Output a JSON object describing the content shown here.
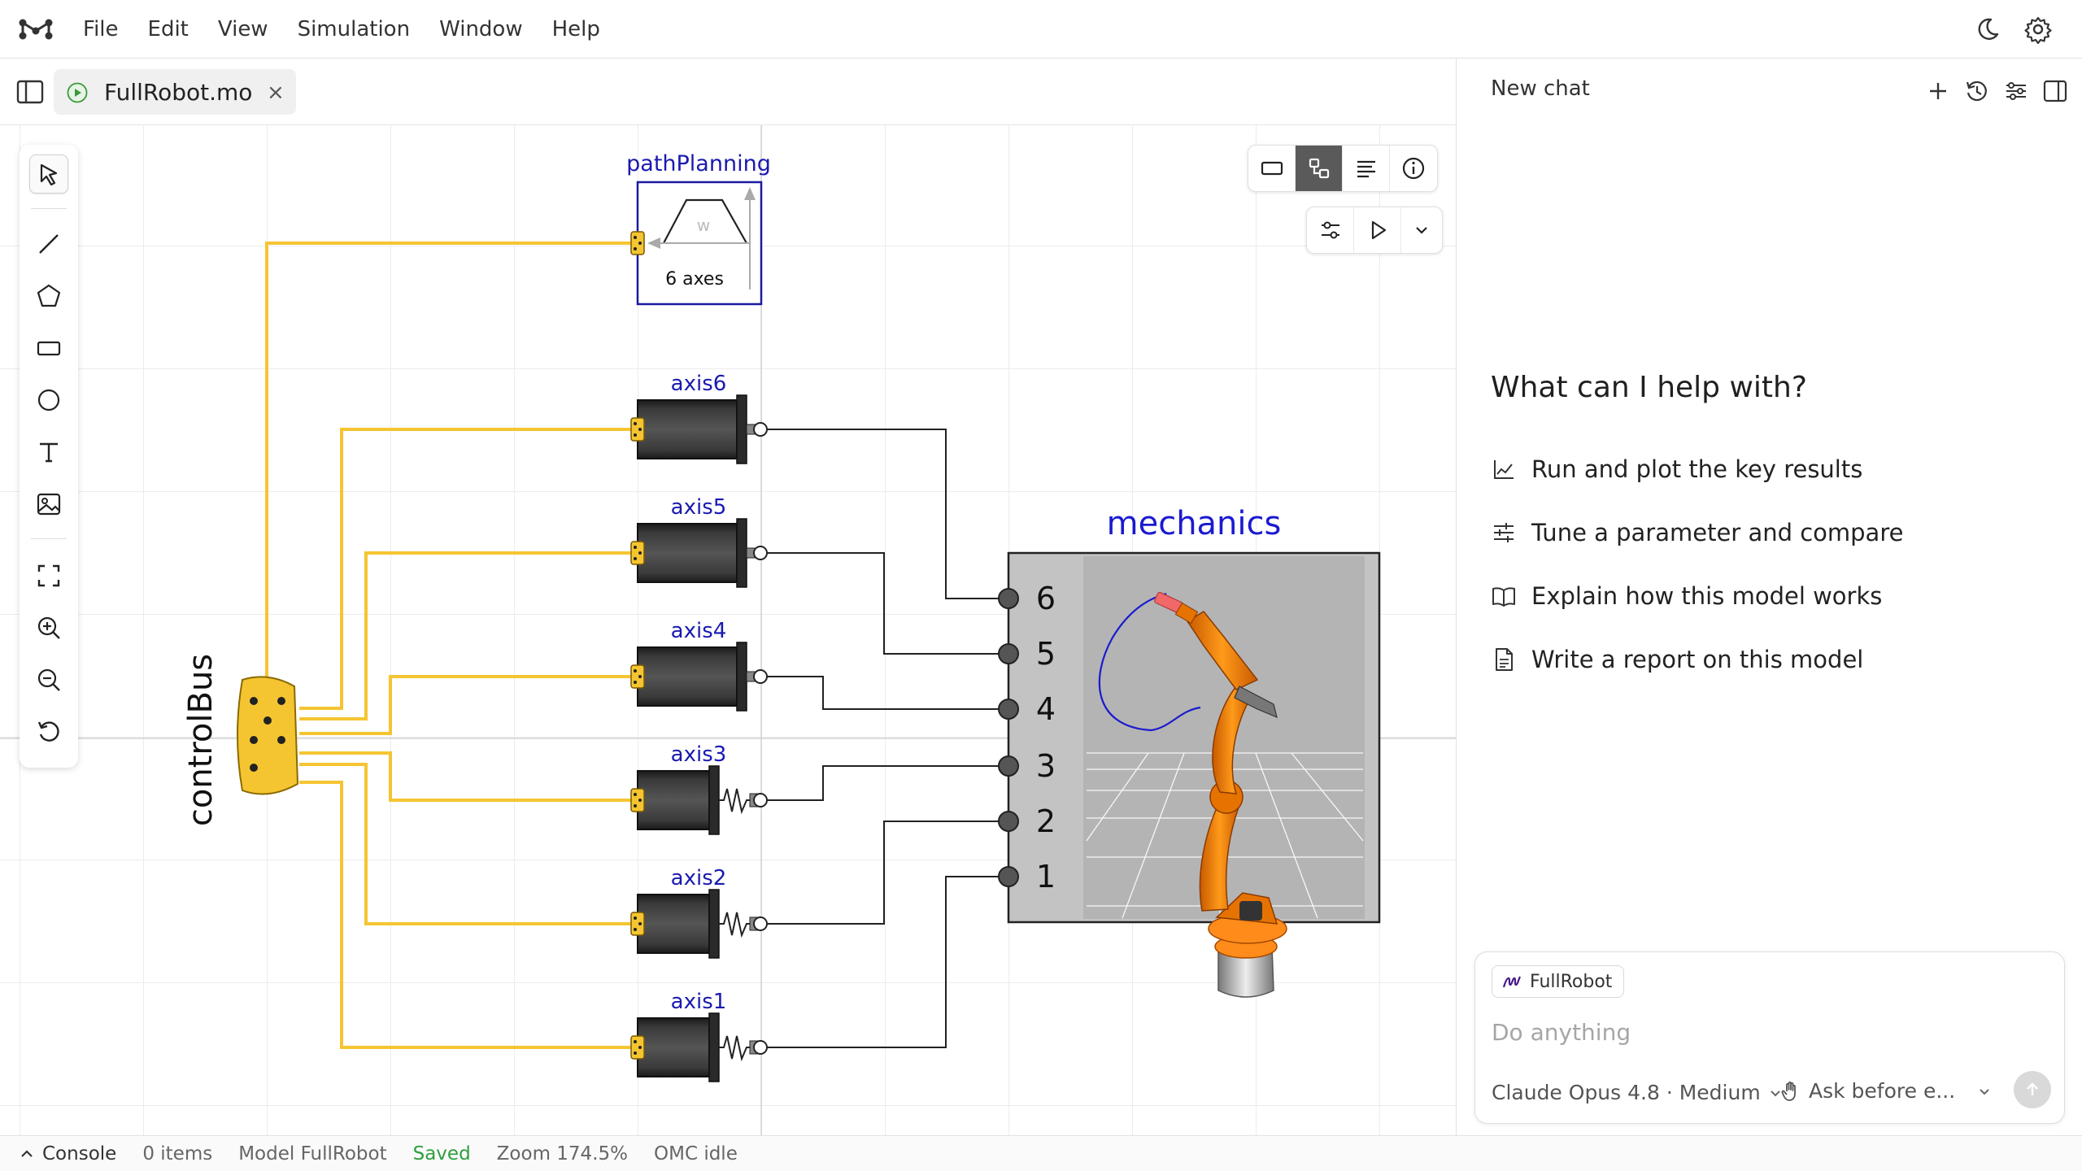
{
  "app": {
    "menu": [
      "File",
      "Edit",
      "View",
      "Simulation",
      "Window",
      "Help"
    ]
  },
  "tab": {
    "name": "FullRobot.mo",
    "close": "×"
  },
  "diagram": {
    "pathPlanning": {
      "label": "pathPlanning",
      "sublabel": "6 axes",
      "icon_letter": "w"
    },
    "controlBus": {
      "label": "controlBus"
    },
    "axes": [
      "axis6",
      "axis5",
      "axis4",
      "axis3",
      "axis2",
      "axis1"
    ],
    "mechanics": {
      "label": "mechanics",
      "ports": [
        "6",
        "5",
        "4",
        "3",
        "2",
        "1"
      ]
    }
  },
  "chat": {
    "title": "New chat",
    "welcome": "What can I help with?",
    "suggestions": [
      {
        "label": "Run and plot the key results",
        "icon": "chart-icon"
      },
      {
        "label": "Tune a parameter and compare",
        "icon": "sliders-icon"
      },
      {
        "label": "Explain how this model works",
        "icon": "book-icon"
      },
      {
        "label": "Write a report on this model",
        "icon": "document-icon"
      }
    ],
    "composer": {
      "context_chip": "FullRobot",
      "placeholder": "Do anything",
      "model": "Claude Opus 4.8 · Medium",
      "permission": "Ask before e..."
    }
  },
  "status": {
    "console": "Console",
    "items": "0 items",
    "model": "Model FullRobot",
    "saved": "Saved",
    "zoom": "Zoom 174.5%",
    "omc": "OMC idle"
  },
  "colors": {
    "bus_line": "#f5c531",
    "component_label": "#1a1ab0",
    "saved": "#2e9e3e"
  }
}
